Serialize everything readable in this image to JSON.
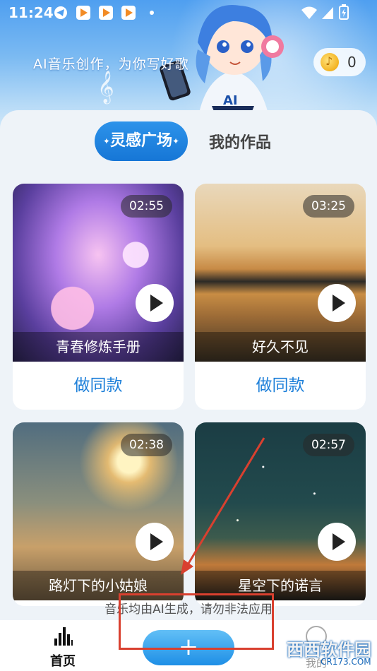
{
  "status_bar": {
    "time": "11:24",
    "icons": [
      "telegram-icon",
      "notification-icon",
      "notification-icon",
      "notification-icon",
      "dot-icon",
      "wifi-icon",
      "signal-icon",
      "battery-icon"
    ]
  },
  "header": {
    "slogan": "AI音乐创作，为你写好歌",
    "coin_count": "0"
  },
  "tabs": [
    {
      "label": "灵感广场",
      "active": true
    },
    {
      "label": "我的作品",
      "active": false
    }
  ],
  "cards": [
    {
      "title": "青春修炼手册",
      "duration": "02:55",
      "action": "做同款"
    },
    {
      "title": "好久不见",
      "duration": "03:25",
      "action": "做同款"
    },
    {
      "title": "路灯下的小姑娘",
      "duration": "02:38"
    },
    {
      "title": "星空下的诺言",
      "duration": "02:57"
    }
  ],
  "disclaimer": "音乐均由AI生成，请勿非法应用",
  "bottom_nav": {
    "home_label": "首页",
    "create_label": "+",
    "mine_label": "我的"
  },
  "watermark": {
    "text": "西西软件园",
    "domain": "CR173.COM"
  },
  "colors": {
    "accent": "#1c7fd9",
    "annotation": "#d9402f"
  }
}
